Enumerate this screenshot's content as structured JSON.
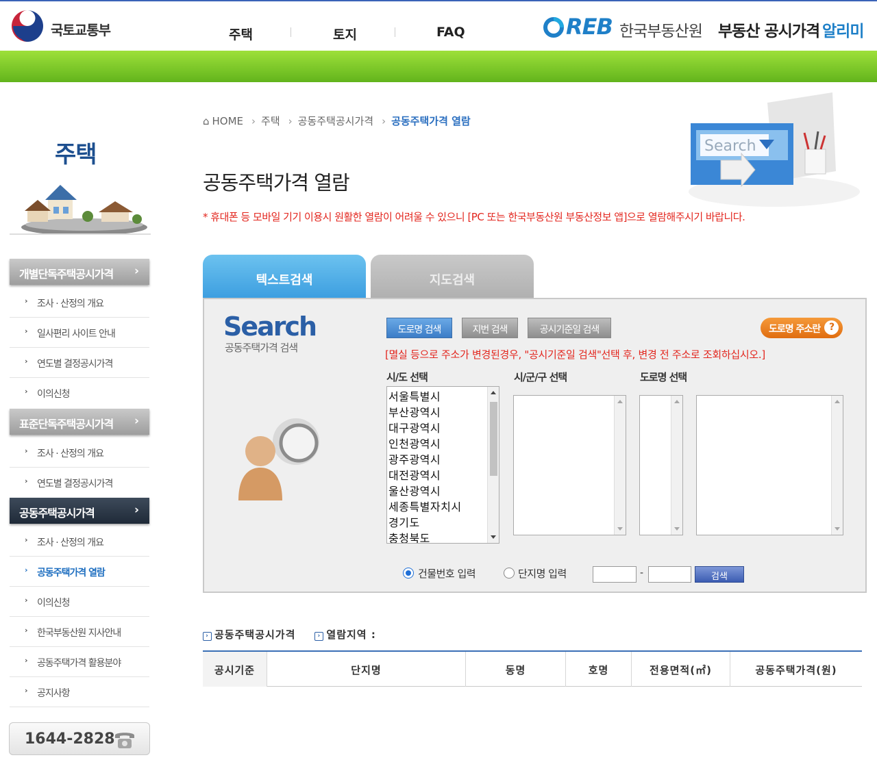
{
  "header": {
    "ministry": "국토교통부",
    "menu": [
      "주택",
      "토지",
      "FAQ"
    ],
    "reb_logo": "REB",
    "reb_name": "한국부동산원",
    "service_name": "부동산 공시가격",
    "service_accent": "알리미",
    "colors": {
      "green": "#7ccc2a",
      "blue": "#1f80c8"
    }
  },
  "sidebar": {
    "title": "주택",
    "groups": [
      {
        "label": "개별단독주택공시가격",
        "items": [
          "조사 · 산정의 개요",
          "일사편리 사이트 안내",
          "연도별 결정공시가격",
          "이의신청"
        ]
      },
      {
        "label": "표준단독주택공시가격",
        "items": [
          "조사 · 산정의 개요",
          "연도별 결정공시가격"
        ]
      },
      {
        "label": "공동주택공시가격",
        "items": [
          "조사 · 산정의 개요",
          "공동주택가격 열람",
          "이의신청",
          "한국부동산원 지사안내",
          "공동주택가격 활용분야",
          "공지사항"
        ]
      }
    ],
    "phone": "1644-2828"
  },
  "breadcrumb": [
    "HOME",
    "주택",
    "공동주택공시가격",
    "공동주택가격 열람"
  ],
  "page_title": "공동주택가격 열람",
  "notice": "* 휴대폰 등 모바일 기기 이용시 원활한 열람이 어려울 수 있으니 [PC 또는 한국부동산원 부동산정보 앱]으로 열람해주시기 바랍니다.",
  "search_art_text": "Search",
  "tabs": [
    "텍스트검색",
    "지도검색"
  ],
  "search_panel": {
    "logo": "Search",
    "logo_sub": "공동주택가격 검색",
    "search_types": [
      "도로명 검색",
      "지번 검색",
      "공시기준일 검색"
    ],
    "road_help": "도로명 주소란",
    "warning": "[멸실 등으로 주소가 변경된경우, \"공시기준일 검색\"선택 후, 변경 전 주소로 조회하십시오.]",
    "labels": {
      "sido": "시/도 선택",
      "sigungu": "시/군/구 선택",
      "road": "도로명 선택"
    },
    "sido_options": [
      "서울특별시",
      "부산광역시",
      "대구광역시",
      "인천광역시",
      "광주광역시",
      "대전광역시",
      "울산광역시",
      "세종특별자치시",
      "경기도",
      "충청북도"
    ],
    "radio_building": "건물번호 입력",
    "radio_complex": "단지명 입력",
    "dash": "-",
    "search_button": "검색"
  },
  "results": {
    "title": "공동주택공시가격",
    "region_label": "열람지역 :",
    "columns": [
      "공시기준",
      "단지명",
      "동명",
      "호명",
      "전용면적(㎡)",
      "공동주택가격(원)"
    ]
  }
}
